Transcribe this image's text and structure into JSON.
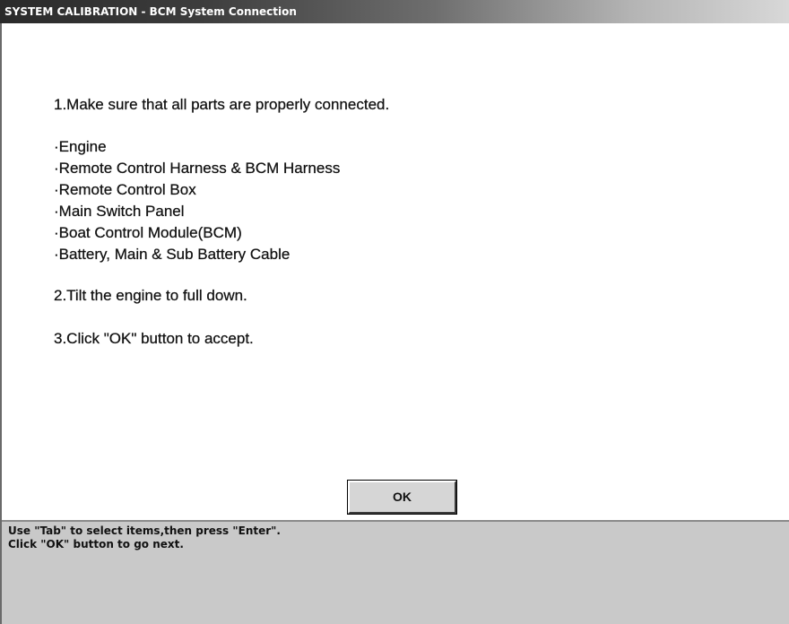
{
  "window": {
    "title": "SYSTEM CALIBRATION - BCM System Connection"
  },
  "instructions": {
    "step1": "1.Make sure that all parts are properly connected.",
    "parts": [
      "·Engine",
      "·Remote Control Harness & BCM Harness",
      "·Remote Control Box",
      "·Main Switch Panel",
      "·Boat Control Module(BCM)",
      "·Battery, Main & Sub Battery Cable"
    ],
    "step2": "2.Tilt the engine to full down.",
    "step3": "3.Click \"OK\" button to accept."
  },
  "buttons": {
    "ok_label": "OK"
  },
  "status": {
    "lines": [
      "Use \"Tab\" to select items,then press \"Enter\".",
      "Click \"OK\" button to go next."
    ]
  }
}
